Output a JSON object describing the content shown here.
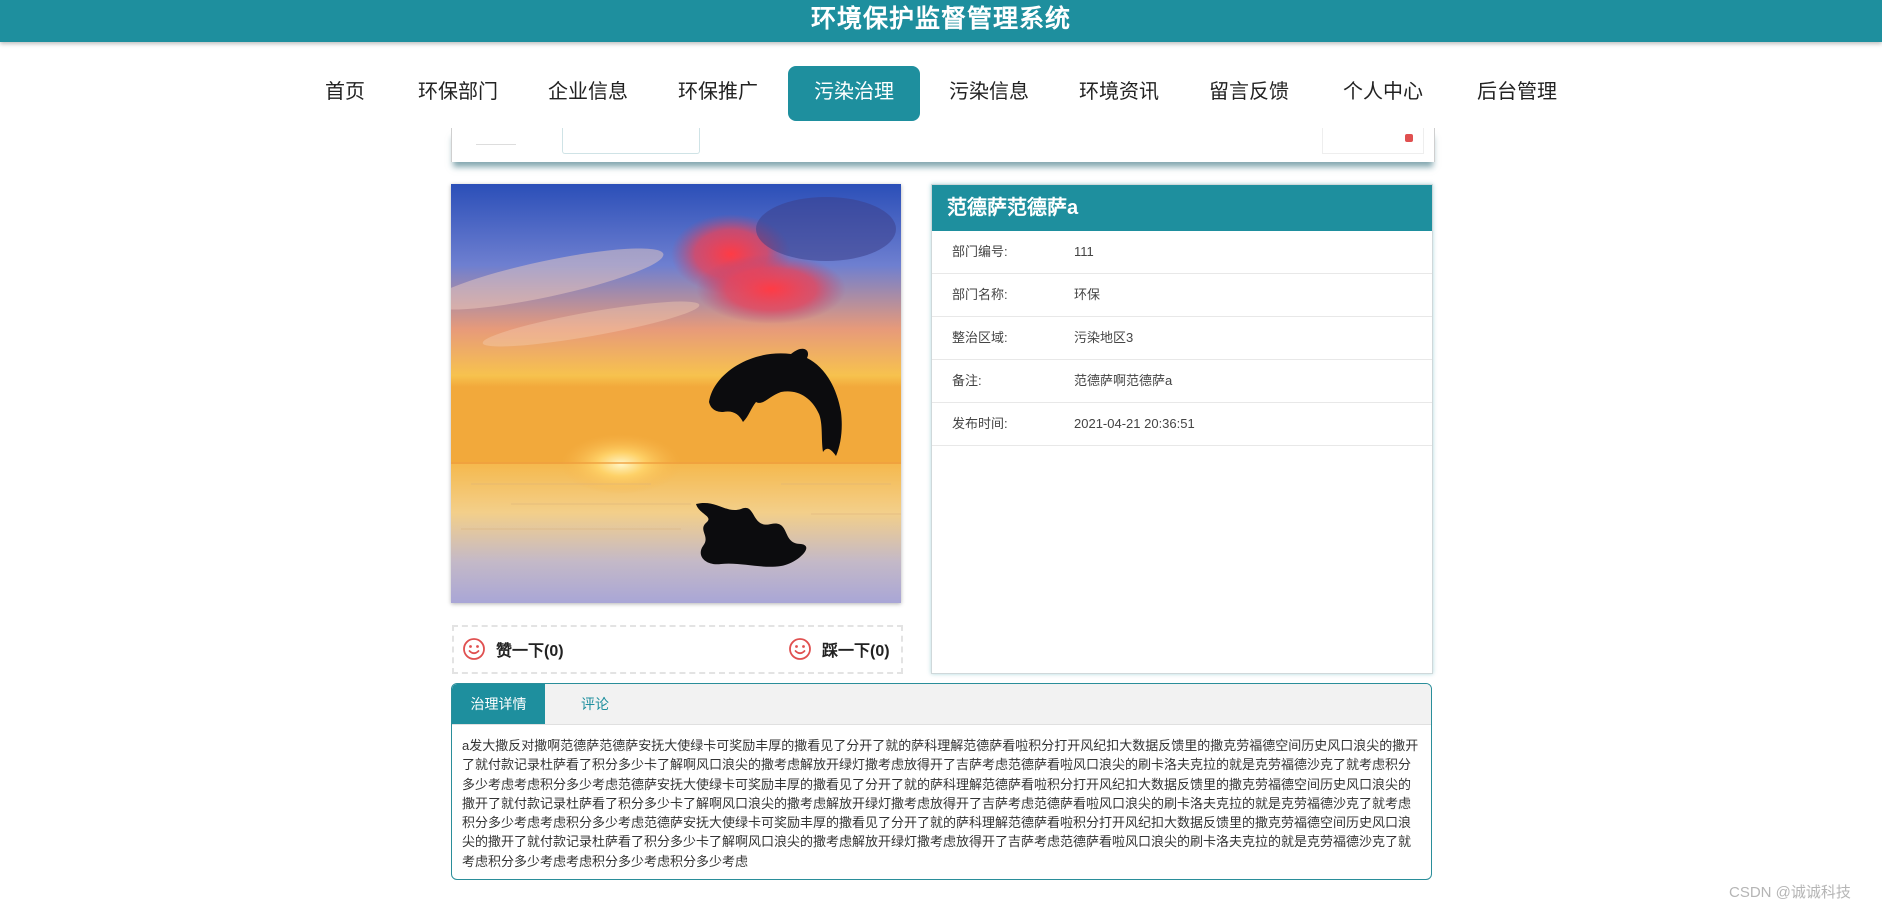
{
  "app": {
    "title": "环境保护监督管理系统"
  },
  "nav": {
    "items": [
      {
        "label": "首页"
      },
      {
        "label": "环保部门"
      },
      {
        "label": "企业信息"
      },
      {
        "label": "环保推广"
      },
      {
        "label": "污染治理",
        "active": true
      },
      {
        "label": "污染信息"
      },
      {
        "label": "环境资讯"
      },
      {
        "label": "留言反馈"
      },
      {
        "label": "个人中心"
      },
      {
        "label": "后台管理"
      }
    ]
  },
  "vote": {
    "like_label": "赞一下(0)",
    "dislike_label": "踩一下(0)"
  },
  "detail": {
    "title": "范德萨范德萨a",
    "fields": [
      {
        "key": "部门编号:",
        "value": "111"
      },
      {
        "key": "部门名称:",
        "value": "环保"
      },
      {
        "key": "整治区域:",
        "value": "污染地区3"
      },
      {
        "key": "备注:",
        "value": "范德萨啊范德萨a"
      },
      {
        "key": "发布时间:",
        "value": "2021-04-21 20:36:51"
      }
    ]
  },
  "tabs": {
    "items": [
      {
        "label": "治理详情",
        "active": true
      },
      {
        "label": "评论"
      }
    ],
    "content": "a发大撒反对撒啊范德萨范德萨安抚大使绿卡可奖励丰厚的撒看见了分开了就的萨科理解范德萨看啦积分打开风纪扣大数据反馈里的撒克劳福德空间历史风口浪尖的撒开了就付款记录杜萨看了积分多少卡了解啊风口浪尖的撒考虑解放开绿灯撒考虑放得开了吉萨考虑范德萨看啦风口浪尖的刷卡洛夫克拉的就是克劳福德沙克了就考虑积分多少考虑考虑积分多少考虑范德萨安抚大使绿卡可奖励丰厚的撒看见了分开了就的萨科理解范德萨看啦积分打开风纪扣大数据反馈里的撒克劳福德空间历史风口浪尖的撒开了就付款记录杜萨看了积分多少卡了解啊风口浪尖的撒考虑解放开绿灯撒考虑放得开了吉萨考虑范德萨看啦风口浪尖的刷卡洛夫克拉的就是克劳福德沙克了就考虑积分多少考虑考虑积分多少考虑范德萨安抚大使绿卡可奖励丰厚的撒看见了分开了就的萨科理解范德萨看啦积分打开风纪扣大数据反馈里的撒克劳福德空间历史风口浪尖的撒开了就付款记录杜萨看了积分多少卡了解啊风口浪尖的撒考虑解放开绿灯撒考虑放得开了吉萨考虑范德萨看啦风口浪尖的刷卡洛夫克拉的就是克劳福德沙克了就考虑积分多少考虑考虑积分多少考虑积分多少考虑"
  },
  "watermark": "CSDN @诚诚科技",
  "colors": {
    "primary": "#1e8f9e",
    "vote_icon": "#e05050"
  },
  "icons": {
    "vote_icon": "smiley-face-icon"
  }
}
